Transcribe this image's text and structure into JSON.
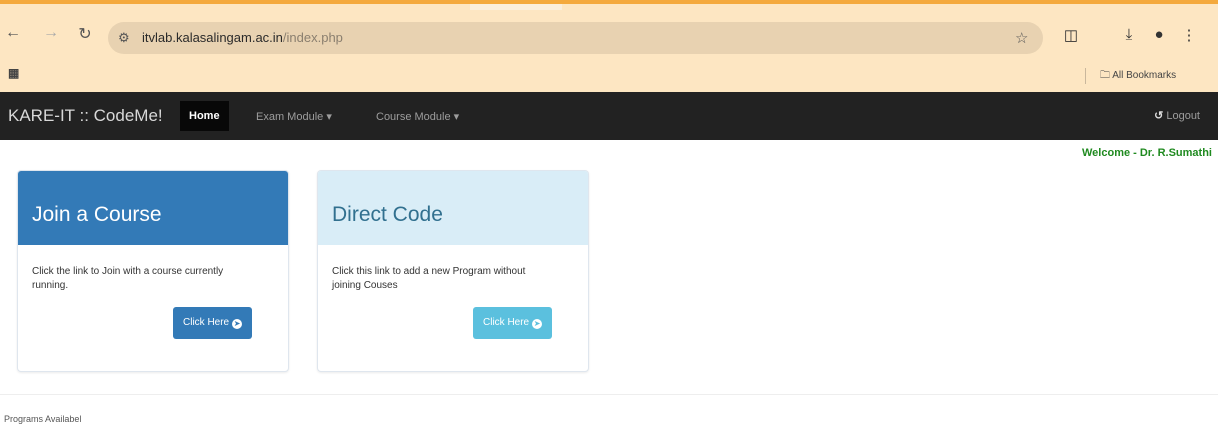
{
  "browser": {
    "url_host": "itvlab.kalasalingam.ac.in",
    "url_path": "/index.php",
    "bookmarks_label": "All Bookmarks"
  },
  "navbar": {
    "brand": "KARE-IT :: CodeMe!",
    "home": "Home",
    "exam_module": "Exam Module",
    "course_module": "Course Module",
    "logout": "Logout"
  },
  "welcome": "Welcome - Dr. R.Sumathi",
  "panels": [
    {
      "title": "Join a Course",
      "body": "Click the link to Join with a course currently running.",
      "button": "Click Here",
      "header_color": "#337ab7",
      "button_color": "#337ab7"
    },
    {
      "title": "Direct Code",
      "body": "Click this link to add a new Program without joining Couses",
      "button": "Click Here",
      "header_color": "#d9edf7",
      "button_color": "#5bc0de"
    }
  ],
  "footer_text": "Programs Availabel"
}
